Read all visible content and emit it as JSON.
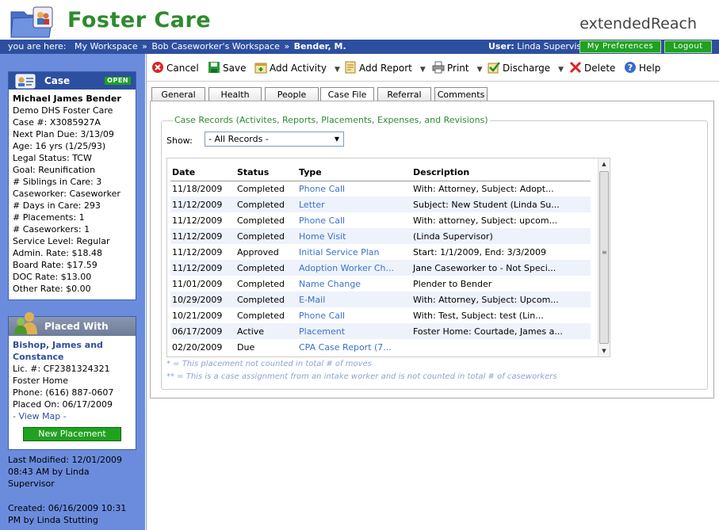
{
  "header": {
    "app_title": "Foster Care",
    "brand_light": "extended",
    "brand_bold": "Reach"
  },
  "nav": {
    "you_are_here": "you are here:",
    "crumbs": [
      "My Workspace",
      "Bob Caseworker's Workspace",
      "Bender, M."
    ],
    "user_label": "User:",
    "user_name": "Linda Supervisor",
    "preferences": "My Preferences",
    "logout": "Logout"
  },
  "case_panel": {
    "title": "Case",
    "badge": "OPEN",
    "name": "Michael James Bender",
    "lines": [
      "Demo DHS Foster Care",
      "Case #: X3085927A",
      "Next Plan Due: 3/13/09",
      "Age: 16 yrs (1/25/93)",
      "Legal Status: TCW",
      "Goal: Reunification",
      "# Siblings in Care: 3",
      "Caseworker: Caseworker",
      "# Days in Care: 293",
      "# Placements: 1",
      "# Caseworkers: 1",
      "Service Level: Regular",
      "Admin. Rate: $18.48",
      "Board Rate: $17.59",
      "DOC Rate: $13.00",
      "Other Rate: $0.00"
    ]
  },
  "placed_panel": {
    "title": "Placed With",
    "name_line1": "Bishop, James and",
    "name_line2": "Constance",
    "lines": [
      "Lic. #: CF2381324321",
      "Foster Home",
      "Phone: (616) 887-0607",
      "Placed On: 06/17/2009"
    ],
    "view_map": "- View Map -",
    "new_placement": "New Placement"
  },
  "meta": {
    "modified": [
      "Last Modified: 12/01/2009",
      "08:43 AM by Linda",
      "Supervisor"
    ],
    "created": [
      "Created: 06/16/2009 10:31",
      "PM by Linda Stutting"
    ]
  },
  "toolbar": {
    "cancel": "Cancel",
    "save": "Save",
    "add_activity": "Add Activity",
    "add_report": "Add Report",
    "print": "Print",
    "discharge": "Discharge",
    "delete": "Delete",
    "help": "Help"
  },
  "tabs": [
    "General",
    "Health",
    "People",
    "Case File",
    "Referral",
    "Comments"
  ],
  "active_tab": "Case File",
  "records": {
    "legend": "Case Records (Activites, Reports, Placements, Expenses, and Revisions)",
    "show_label": "Show:",
    "filter": "- All Records -",
    "columns": [
      "Date",
      "Status",
      "Type",
      "Description"
    ],
    "rows": [
      {
        "date": "11/18/2009",
        "status": "Completed",
        "type": "Phone Call",
        "desc": "With: Attorney, Subject: Adopt..."
      },
      {
        "date": "11/12/2009",
        "status": "Completed",
        "type": "Letter",
        "desc": "Subject: New Student (Linda Su..."
      },
      {
        "date": "11/12/2009",
        "status": "Completed",
        "type": "Phone Call",
        "desc": "With: attorney, Subject: upcom..."
      },
      {
        "date": "11/12/2009",
        "status": "Completed",
        "type": "Home Visit",
        "desc": "(Linda Supervisor)"
      },
      {
        "date": "11/12/2009",
        "status": "Approved",
        "type": "Initial Service Plan",
        "desc": "Start: 1/1/2009, End: 3/3/2009"
      },
      {
        "date": "11/12/2009",
        "status": "Completed",
        "type": "Adoption Worker Ch...",
        "desc": "Jane Caseworker to - Not Speci..."
      },
      {
        "date": "11/01/2009",
        "status": "Completed",
        "type": "Name Change",
        "desc": "Plender to Bender"
      },
      {
        "date": "10/29/2009",
        "status": "Completed",
        "type": "E-Mail",
        "desc": "With: Attorney, Subject: Upcom..."
      },
      {
        "date": "10/21/2009",
        "status": "Completed",
        "type": "Phone Call",
        "desc": "With: Test, Subject: test (Lin..."
      },
      {
        "date": "06/17/2009",
        "status": "Active",
        "type": "Placement",
        "desc": "Foster Home: Courtade, James a..."
      },
      {
        "date": "02/20/2009",
        "status": "Due",
        "type": "CPA Case Report (7...",
        "desc": ""
      }
    ],
    "note1": "* = This placement not counted in total # of moves",
    "note2": "** = This is a case assignment from an intake worker and is not counted in total # of caseworkers"
  },
  "colors": {
    "brand_green": "#2e8b2e",
    "nav_blue": "#2d4f9f",
    "sidebar_blue": "#6b8cdc",
    "link_blue": "#3a72c8"
  }
}
